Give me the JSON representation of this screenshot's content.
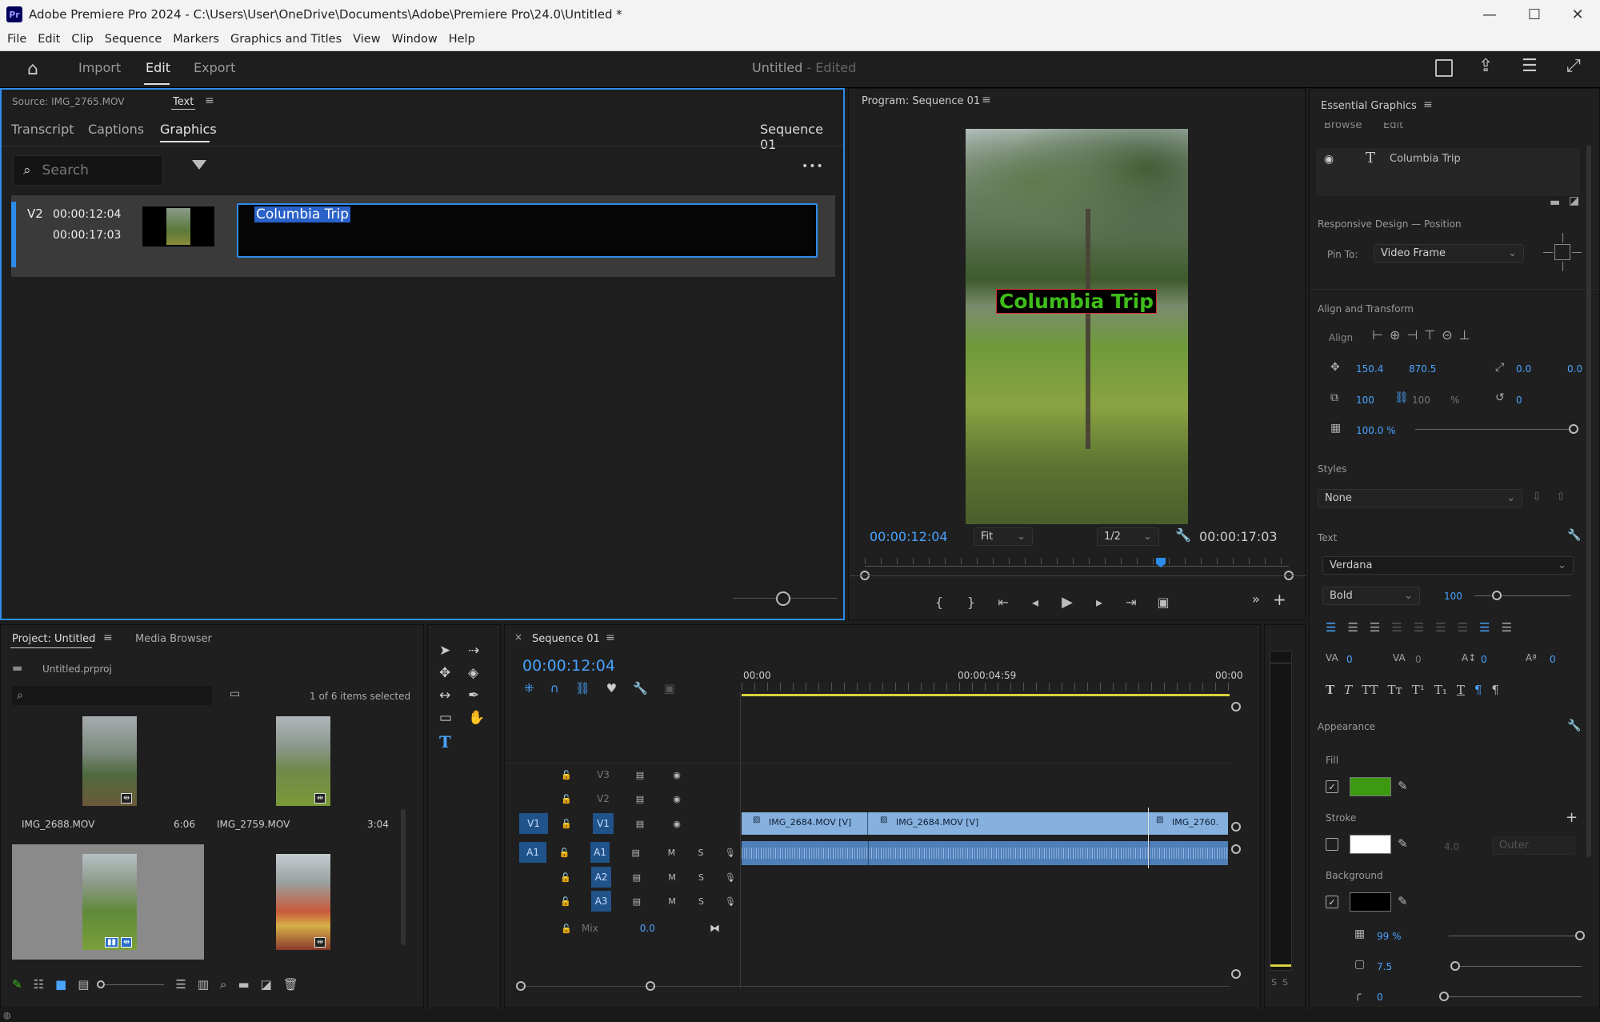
{
  "window": {
    "app_icon": "Pr",
    "title": "Adobe Premiere Pro 2024 - C:\\Users\\User\\OneDrive\\Documents\\Adobe\\Premiere Pro\\24.0\\Untitled *",
    "minimize": "—",
    "maximize": "☐",
    "close": "✕"
  },
  "menu": [
    "File",
    "Edit",
    "Clip",
    "Sequence",
    "Markers",
    "Graphics and Titles",
    "View",
    "Window",
    "Help"
  ],
  "header": {
    "tabs": [
      "Import",
      "Edit",
      "Export"
    ],
    "active_tab": "Edit",
    "project_title": "Untitled",
    "project_state": "- Edited"
  },
  "text_panel": {
    "source_label": "Source: IMG_2765.MOV",
    "text_tab": "Text",
    "subtabs": [
      "Transcript",
      "Captions",
      "Graphics"
    ],
    "active_subtab": "Graphics",
    "sequence_name": "Sequence 01",
    "search_placeholder": "Search",
    "item": {
      "track": "V2",
      "in_time": "00:00:12:04",
      "out_time": "00:00:17:03",
      "text": "Columbia Trip"
    },
    "more": "•••"
  },
  "program": {
    "title": "Program: Sequence 01",
    "overlay_text": "Columbia Trip",
    "current_time": "00:00:12:04",
    "fit": "Fit",
    "resolution": "1/2",
    "duration": "00:00:17:03"
  },
  "essential_graphics": {
    "title": "Essential Graphics",
    "tabs": [
      "Browse",
      "Edit"
    ],
    "layer_name": "Columbia Trip",
    "responsive_label": "Responsive Design — Position",
    "pin_to_label": "Pin To:",
    "pin_to_value": "Video Frame",
    "align_transform_label": "Align and Transform",
    "align_label": "Align",
    "pos_x": "150.4",
    "pos_y": "870.5",
    "anchor_x": "0.0",
    "anchor_y": "0.0",
    "scale": "100",
    "scale2": "100",
    "pct": "%",
    "rotation": "0",
    "opacity": "100.0 %",
    "styles_label": "Styles",
    "styles_value": "None",
    "text_label": "Text",
    "font": "Verdana",
    "weight": "Bold",
    "size": "100",
    "tracking": "0",
    "kerning": "0",
    "leading": "0",
    "baseline": "0",
    "appearance_label": "Appearance",
    "fill_label": "Fill",
    "stroke_label": "Stroke",
    "stroke_width": "4.0",
    "stroke_type": "Outer",
    "background_label": "Background",
    "bg_opacity": "99 %",
    "bg_size": "7.5",
    "bg_corner": "0",
    "colors": {
      "fill": "#3d9a10",
      "stroke": "#ffffff",
      "background": "#000000"
    }
  },
  "project": {
    "tab": "Project: Untitled",
    "media_browser": "Media Browser",
    "file": "Untitled.prproj",
    "selection": "1 of 6 items selected",
    "items": [
      {
        "name": "IMG_2688.MOV",
        "dur": "6:06"
      },
      {
        "name": "IMG_2759.MOV",
        "dur": "3:04"
      },
      {
        "name": "",
        "dur": ""
      },
      {
        "name": "",
        "dur": ""
      }
    ]
  },
  "timeline": {
    "tab": "Sequence 01",
    "timecode": "00:00:12:04",
    "ruler": [
      "00:00",
      "00:00:04:59",
      "00:00"
    ],
    "tracks": [
      {
        "label": "V3"
      },
      {
        "label": "V2"
      },
      {
        "label": "V1",
        "src": "V1"
      },
      {
        "label": "A1",
        "src": "A1"
      },
      {
        "label": "A2"
      },
      {
        "label": "A3"
      }
    ],
    "mix_label": "Mix",
    "mix_value": "0.0",
    "clips": [
      "IMG_2684.MOV [V]",
      "IMG_2684.MOV [V]",
      "IMG_2760."
    ],
    "meter_labels": [
      "S",
      "S"
    ]
  }
}
